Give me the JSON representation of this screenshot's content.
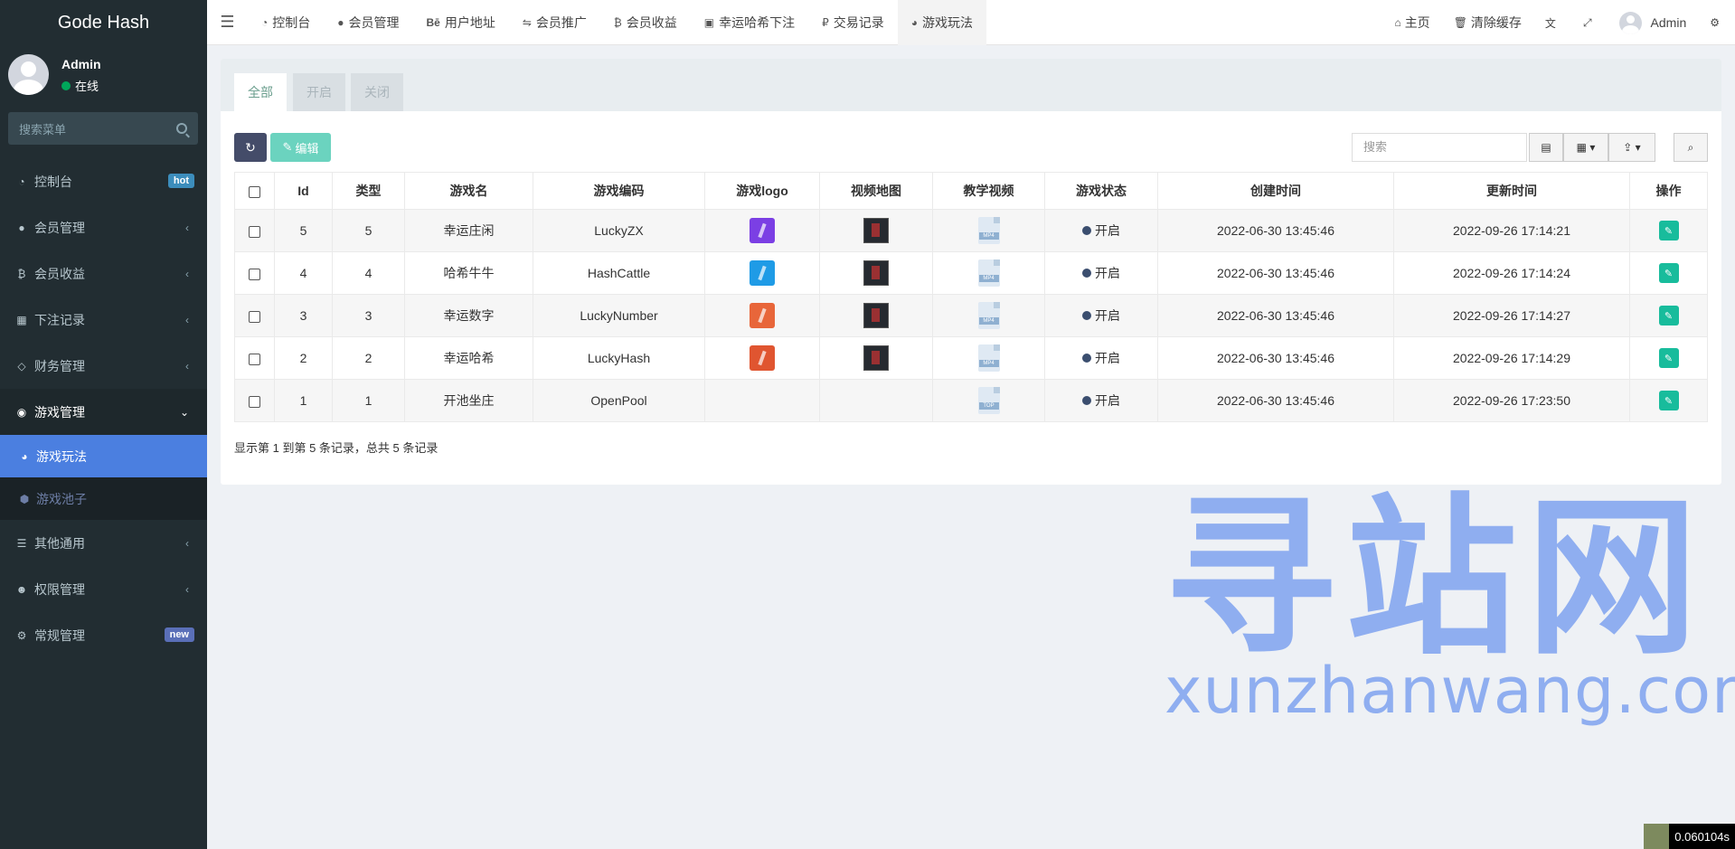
{
  "app": {
    "title": "Gode Hash"
  },
  "user": {
    "name": "Admin",
    "status": "在线"
  },
  "sidebar": {
    "search_placeholder": "搜索菜单",
    "items": [
      {
        "label": "控制台",
        "icon": "dashboard-icon",
        "badge": "hot"
      },
      {
        "label": "会员管理",
        "icon": "user-circle-icon"
      },
      {
        "label": "会员收益",
        "icon": "bitcoin-icon"
      },
      {
        "label": "下注记录",
        "icon": "calendar-icon"
      },
      {
        "label": "财务管理",
        "icon": "diamond-icon"
      },
      {
        "label": "游戏管理",
        "icon": "gamepad-icon"
      },
      {
        "label": "其他通用",
        "icon": "list-icon"
      },
      {
        "label": "权限管理",
        "icon": "group-icon"
      },
      {
        "label": "常规管理",
        "icon": "cogs-icon",
        "badge": "new"
      }
    ],
    "sub_items": [
      {
        "label": "游戏玩法",
        "icon": "compass-icon"
      },
      {
        "label": "游戏池子",
        "icon": "cube-icon"
      }
    ]
  },
  "topnav": {
    "tabs": [
      {
        "label": "控制台",
        "icon": "dashboard-icon"
      },
      {
        "label": "会员管理",
        "icon": "user-icon"
      },
      {
        "label": "用户地址",
        "icon": "behance-icon"
      },
      {
        "label": "会员推广",
        "icon": "handshake-icon"
      },
      {
        "label": "会员收益",
        "icon": "bitcoin-icon"
      },
      {
        "label": "幸运哈希下注",
        "icon": "calendar-check-icon"
      },
      {
        "label": "交易记录",
        "icon": "ruble-icon"
      },
      {
        "label": "游戏玩法",
        "icon": "compass-icon"
      }
    ],
    "right": {
      "home": "主页",
      "clear_cache": "清除缓存",
      "admin": "Admin"
    }
  },
  "panel": {
    "tabs": [
      "全部",
      "开启",
      "关闭"
    ],
    "edit_label": "编辑",
    "search_placeholder": "搜索",
    "columns": [
      "Id",
      "类型",
      "游戏名",
      "游戏编码",
      "游戏logo",
      "视频地图",
      "教学视频",
      "游戏状态",
      "创建时间",
      "更新时间",
      "操作"
    ],
    "rows": [
      {
        "id": "5",
        "type": "5",
        "name": "幸运庄闲",
        "code": "LuckyZX",
        "logo_color": "#7b3fe4",
        "has_media": true,
        "video": "MP4",
        "status": "开启",
        "created": "2022-06-30 13:45:46",
        "updated": "2022-09-26 17:14:21"
      },
      {
        "id": "4",
        "type": "4",
        "name": "哈希牛牛",
        "code": "HashCattle",
        "logo_color": "#1f9be6",
        "has_media": true,
        "video": "MP4",
        "status": "开启",
        "created": "2022-06-30 13:45:46",
        "updated": "2022-09-26 17:14:24"
      },
      {
        "id": "3",
        "type": "3",
        "name": "幸运数字",
        "code": "LuckyNumber",
        "logo_color": "#e8663a",
        "has_media": true,
        "video": "MP4",
        "status": "开启",
        "created": "2022-06-30 13:45:46",
        "updated": "2022-09-26 17:14:27"
      },
      {
        "id": "2",
        "type": "2",
        "name": "幸运哈希",
        "code": "LuckyHash",
        "logo_color": "#e05530",
        "has_media": true,
        "video": "MP4",
        "status": "开启",
        "created": "2022-06-30 13:45:46",
        "updated": "2022-09-26 17:14:29"
      },
      {
        "id": "1",
        "type": "1",
        "name": "开池坐庄",
        "code": "OpenPool",
        "logo_color": "",
        "has_media": false,
        "video": "TOP",
        "status": "开启",
        "created": "2022-06-30 13:45:46",
        "updated": "2022-09-26 17:23:50"
      }
    ],
    "pager": "显示第 1 到第 5 条记录，总共 5 条记录"
  },
  "watermark": {
    "big": "寻站网",
    "small": "xunzhanwang.com"
  },
  "timer": "0.060104s",
  "colors": {
    "sidebar": "#222d32",
    "active": "#4b7fe0",
    "accent": "#18bc9c"
  }
}
